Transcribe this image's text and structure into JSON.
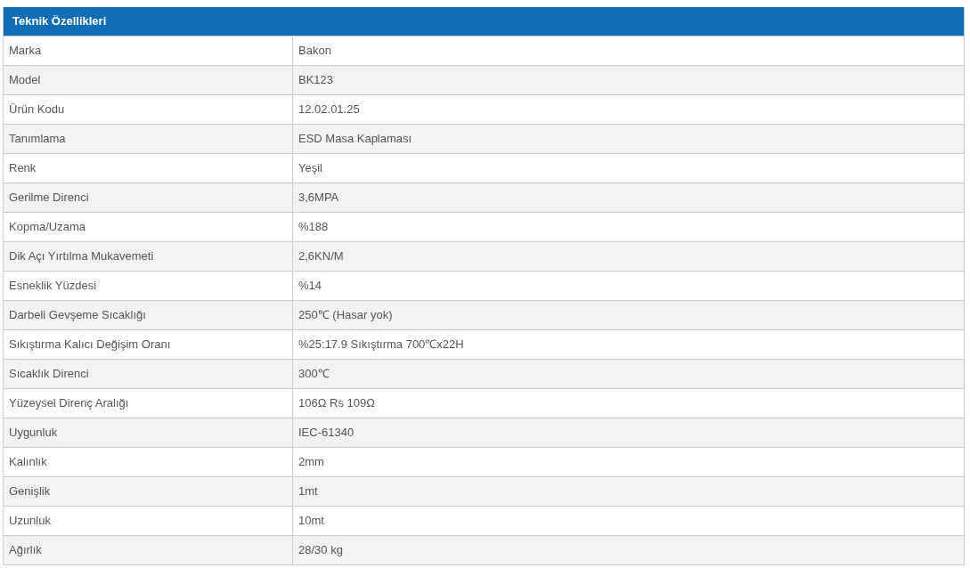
{
  "table": {
    "title": "Teknik Özellikleri",
    "rows": [
      {
        "label": "Marka",
        "value": "Bakon"
      },
      {
        "label": "Model",
        "value": "BK123"
      },
      {
        "label": "Ürün Kodu",
        "value": "12.02.01.25"
      },
      {
        "label": "Tanımlama",
        "value": "ESD Masa Kaplaması"
      },
      {
        "label": "Renk",
        "value": "Yeşil"
      },
      {
        "label": "Gerilme Direnci",
        "value": "3,6MPA"
      },
      {
        "label": "Kopma/Uzama",
        "value": "%188"
      },
      {
        "label": "Dik Açı Yırtılma Mukavemeti",
        "value": "2,6KN/M"
      },
      {
        "label": "Esneklik Yüzdesi",
        "value": "%14"
      },
      {
        "label": "Darbeli Gevşeme Sıcaklığı",
        "value": "250℃ (Hasar yok)"
      },
      {
        "label": "Sıkıştırma Kalıcı Değişim Oranı",
        "value": "%25:17.9 Sıkıştırma 700℃x22H"
      },
      {
        "label": "Sıcaklık Direnci",
        "value": "300℃"
      },
      {
        "label": "Yüzeysel Direnç Aralığı",
        "value": "106Ω Rs 109Ω"
      },
      {
        "label": "Uygunluk",
        "value": "IEC-61340"
      },
      {
        "label": "Kalınlık",
        "value": "2mm"
      },
      {
        "label": "Genişlik",
        "value": "1mt"
      },
      {
        "label": "Uzunluk",
        "value": "10mt"
      },
      {
        "label": "Ağırlık",
        "value": "28/30 kg"
      }
    ]
  }
}
